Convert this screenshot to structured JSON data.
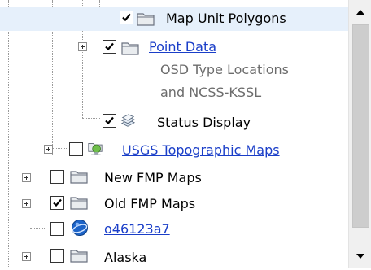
{
  "tree": {
    "items": [
      {
        "label": "Map Unit Polygons",
        "checked": true,
        "icon": "folder-icon"
      },
      {
        "label": "Point Data",
        "checked": true,
        "icon": "folder-icon",
        "description": [
          "OSD Type Locations",
          "and NCSS-KSSL"
        ]
      },
      {
        "label": "Status Display",
        "checked": true,
        "icon": "layers-icon"
      },
      {
        "label": "USGS Topographic Maps",
        "checked": false,
        "icon": "network-folder-icon"
      },
      {
        "label": "New FMP Maps",
        "checked": false,
        "icon": "folder-icon"
      },
      {
        "label": "Old FMP Maps",
        "checked": true,
        "icon": "folder-icon"
      },
      {
        "label": "o46123a7",
        "checked": false,
        "icon": "globe-icon"
      },
      {
        "label": "Alaska",
        "checked": false,
        "icon": "folder-icon"
      }
    ]
  },
  "scrollbar": {
    "up_icon": "arrow-up-icon",
    "down_icon": "arrow-down-icon"
  },
  "colors": {
    "link": "#1a3ec8",
    "selected_row": "#e6f0fb",
    "description_text": "#6c6c6c"
  }
}
